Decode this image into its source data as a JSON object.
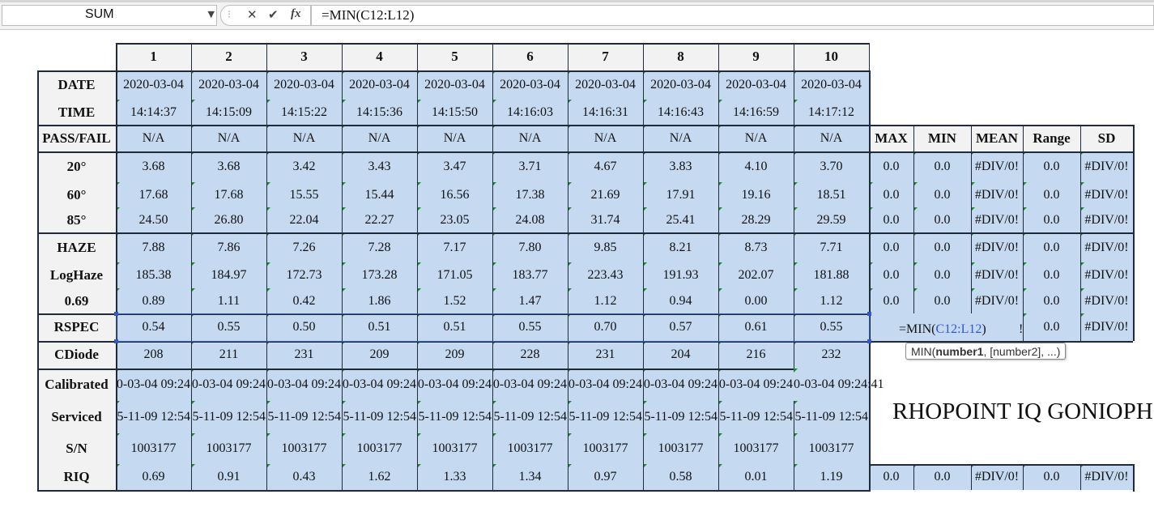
{
  "formula_bar": {
    "name_box": "SUM",
    "cancel_symbol": "✕",
    "enter_symbol": "✔",
    "fx_symbol": "fx",
    "formula": "=MIN(C12:L12)"
  },
  "columns": [
    "1",
    "2",
    "3",
    "4",
    "5",
    "6",
    "7",
    "8",
    "9",
    "10"
  ],
  "stat_headers": [
    "MAX",
    "MIN",
    "MEAN",
    "Range",
    "SD"
  ],
  "rows": [
    {
      "label": "DATE",
      "values": [
        "2020-03-04",
        "2020-03-04",
        "2020-03-04",
        "2020-03-04",
        "2020-03-04",
        "2020-03-04",
        "2020-03-04",
        "2020-03-04",
        "2020-03-04",
        "2020-03-04"
      ]
    },
    {
      "label": "TIME",
      "values": [
        "14:14:37",
        "14:15:09",
        "14:15:22",
        "14:15:36",
        "14:15:50",
        "14:16:03",
        "14:16:31",
        "14:16:43",
        "14:16:59",
        "14:17:12"
      ]
    },
    {
      "label": "PASS/FAIL",
      "values": [
        "N/A",
        "N/A",
        "N/A",
        "N/A",
        "N/A",
        "N/A",
        "N/A",
        "N/A",
        "N/A",
        "N/A"
      ]
    },
    {
      "label": "20°",
      "values": [
        "3.68",
        "3.68",
        "3.42",
        "3.43",
        "3.47",
        "3.71",
        "4.67",
        "3.83",
        "4.10",
        "3.70"
      ],
      "stats": [
        "0.0",
        "0.0",
        "#DIV/0!",
        "0.0",
        "#DIV/0!"
      ]
    },
    {
      "label": "60°",
      "values": [
        "17.68",
        "17.68",
        "15.55",
        "15.44",
        "16.56",
        "17.38",
        "21.69",
        "17.91",
        "19.16",
        "18.51"
      ],
      "stats": [
        "0.0",
        "0.0",
        "#DIV/0!",
        "0.0",
        "#DIV/0!"
      ]
    },
    {
      "label": "85°",
      "values": [
        "24.50",
        "26.80",
        "22.04",
        "22.27",
        "23.05",
        "24.08",
        "31.74",
        "25.41",
        "28.29",
        "29.59"
      ],
      "stats": [
        "0.0",
        "0.0",
        "#DIV/0!",
        "0.0",
        "#DIV/0!"
      ]
    },
    {
      "label": "HAZE",
      "values": [
        "7.88",
        "7.86",
        "7.26",
        "7.28",
        "7.17",
        "7.80",
        "9.85",
        "8.21",
        "8.73",
        "7.71"
      ],
      "stats": [
        "0.0",
        "0.0",
        "#DIV/0!",
        "0.0",
        "#DIV/0!"
      ]
    },
    {
      "label": "LogHaze",
      "values": [
        "185.38",
        "184.97",
        "172.73",
        "173.28",
        "171.05",
        "183.77",
        "223.43",
        "191.93",
        "202.07",
        "181.88"
      ],
      "stats": [
        "0.0",
        "0.0",
        "#DIV/0!",
        "0.0",
        "#DIV/0!"
      ]
    },
    {
      "label": "0.69",
      "values": [
        "0.89",
        "1.11",
        "0.42",
        "1.86",
        "1.52",
        "1.47",
        "1.12",
        "0.94",
        "0.00",
        "1.12"
      ],
      "stats": [
        "0.0",
        "0.0",
        "#DIV/0!",
        "0.0",
        "#DIV/0!"
      ]
    },
    {
      "label": "RSPEC",
      "values": [
        "0.54",
        "0.55",
        "0.50",
        "0.51",
        "0.51",
        "0.55",
        "0.70",
        "0.57",
        "0.61",
        "0.55"
      ],
      "stats": [
        "",
        "",
        "",
        "0.0",
        "#DIV/0!"
      ]
    },
    {
      "label": "CDiode",
      "values": [
        "208",
        "211",
        "231",
        "209",
        "209",
        "228",
        "231",
        "204",
        "216",
        "232"
      ]
    },
    {
      "label": "Calibrated",
      "values": [
        "0-03-04 09:24",
        "0-03-04 09:24",
        "0-03-04 09:24",
        "0-03-04 09:24",
        "0-03-04 09:24",
        "0-03-04 09:24",
        "0-03-04 09:24",
        "0-03-04 09:24",
        "0-03-04 09:24",
        "0-03-04 09:24:41"
      ]
    },
    {
      "label": "Serviced",
      "values": [
        "5-11-09 12:54",
        "5-11-09 12:54",
        "5-11-09 12:54",
        "5-11-09 12:54",
        "5-11-09 12:54",
        "5-11-09 12:54",
        "5-11-09 12:54",
        "5-11-09 12:54",
        "5-11-09 12:54",
        "5-11-09 12:54"
      ]
    },
    {
      "label": "S/N",
      "values": [
        "1003177",
        "1003177",
        "1003177",
        "1003177",
        "1003177",
        "1003177",
        "1003177",
        "1003177",
        "1003177",
        "1003177"
      ]
    },
    {
      "label": "RIQ",
      "values": [
        "0.69",
        "0.91",
        "0.43",
        "1.62",
        "1.33",
        "1.34",
        "0.97",
        "0.58",
        "0.01",
        "1.19"
      ],
      "stats": [
        "0.0",
        "0.0",
        "#DIV/0!",
        "0.0",
        "#DIV/0!"
      ]
    }
  ],
  "editing_cell": {
    "prefix": "=MIN(",
    "ref": "C12:L12",
    "suffix": ")",
    "overflow": "!"
  },
  "tooltip": {
    "fn": "MIN(",
    "arg1": "number1",
    "rest": ", [number2], ...)"
  },
  "title_text": "RHOPOINT IQ GONIOPHO",
  "colors": {
    "data_fill": "#c5d9f1",
    "label_fill": "#f2f2f2",
    "border": "#1f2b3a",
    "selection": "#2f57d8",
    "comment_marker": "#1b8a2c"
  }
}
